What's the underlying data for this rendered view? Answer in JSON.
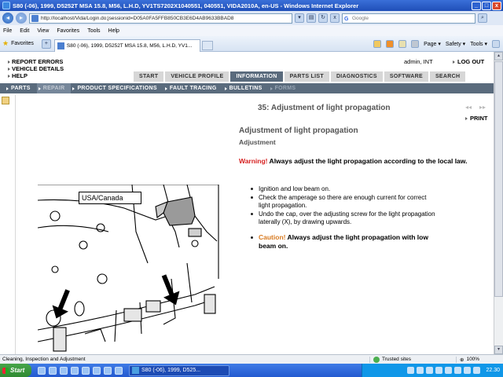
{
  "window": {
    "title": "S80 (-06), 1999, D5252T MSA 15.8, M56, L.H.D, YV1TS7202X1040551, 040551, VIDA2010A, en-US - Windows Internet Explorer",
    "minimize": "_",
    "maximize": "□",
    "close": "x"
  },
  "browser": {
    "url": "http://localhost/Vida/Login.do;jsessionid=D05A0FA5FFB850CB3E6D4AB9633BBAD8",
    "search_placeholder": "Google",
    "menu": [
      "File",
      "Edit",
      "View",
      "Favorites",
      "Tools",
      "Help"
    ],
    "favorites_label": "Favorites",
    "tab_title": "S80 (-06), 1999, D5252T MSA 15.8, M56, L.H.D, YV1...",
    "commands": [
      "Page ▾",
      "Safety ▾",
      "Tools ▾"
    ]
  },
  "vida": {
    "left_links": [
      "REPORT ERRORS",
      "VEHICLE DETAILS",
      "HELP"
    ],
    "user": "admin, INT",
    "logout": "LOG OUT",
    "tabs": [
      {
        "label": "START",
        "active": false
      },
      {
        "label": "VEHICLE PROFILE",
        "active": false
      },
      {
        "label": "INFORMATION",
        "active": true
      },
      {
        "label": "PARTS LIST",
        "active": false
      },
      {
        "label": "DIAGNOSTICS",
        "active": false
      },
      {
        "label": "SOFTWARE",
        "active": false
      },
      {
        "label": "SEARCH",
        "active": false
      }
    ],
    "subnav": [
      {
        "label": "PARTS",
        "state": "normal"
      },
      {
        "label": "REPAIR",
        "state": "active"
      },
      {
        "label": "PRODUCT SPECIFICATIONS",
        "state": "normal"
      },
      {
        "label": "FAULT TRACING",
        "state": "normal"
      },
      {
        "label": "BULLETINS",
        "state": "normal"
      },
      {
        "label": "FORMS",
        "state": "dim"
      }
    ]
  },
  "document": {
    "header": "35: Adjustment of light propagation",
    "nav_prev": "◂◂",
    "nav_next": "▸▸",
    "print": "PRINT",
    "title": "Adjustment of light propagation",
    "subtitle": "Adjustment",
    "warning_label": "Warning!",
    "warning_text": " Always adjust the light propagation according to the local law.",
    "steps": [
      "Ignition and low beam on.",
      "Check the amperage so there are enough current for correct light propagation.",
      "Undo the cap, over the adjusting screw for the light propagation laterally (X), by drawing upwards."
    ],
    "caution_label": "Caution!",
    "caution_text": " Always adjust the light propagation with low beam on.",
    "figure_label": "USA/Canada"
  },
  "status": {
    "text": "Cleaning, Inspection and Adjustment",
    "zone": "Trusted sites",
    "zoom": "100%"
  },
  "taskbar": {
    "start": "Start",
    "task": "S80 (-06), 1999, D525...",
    "clock": "22.30"
  }
}
